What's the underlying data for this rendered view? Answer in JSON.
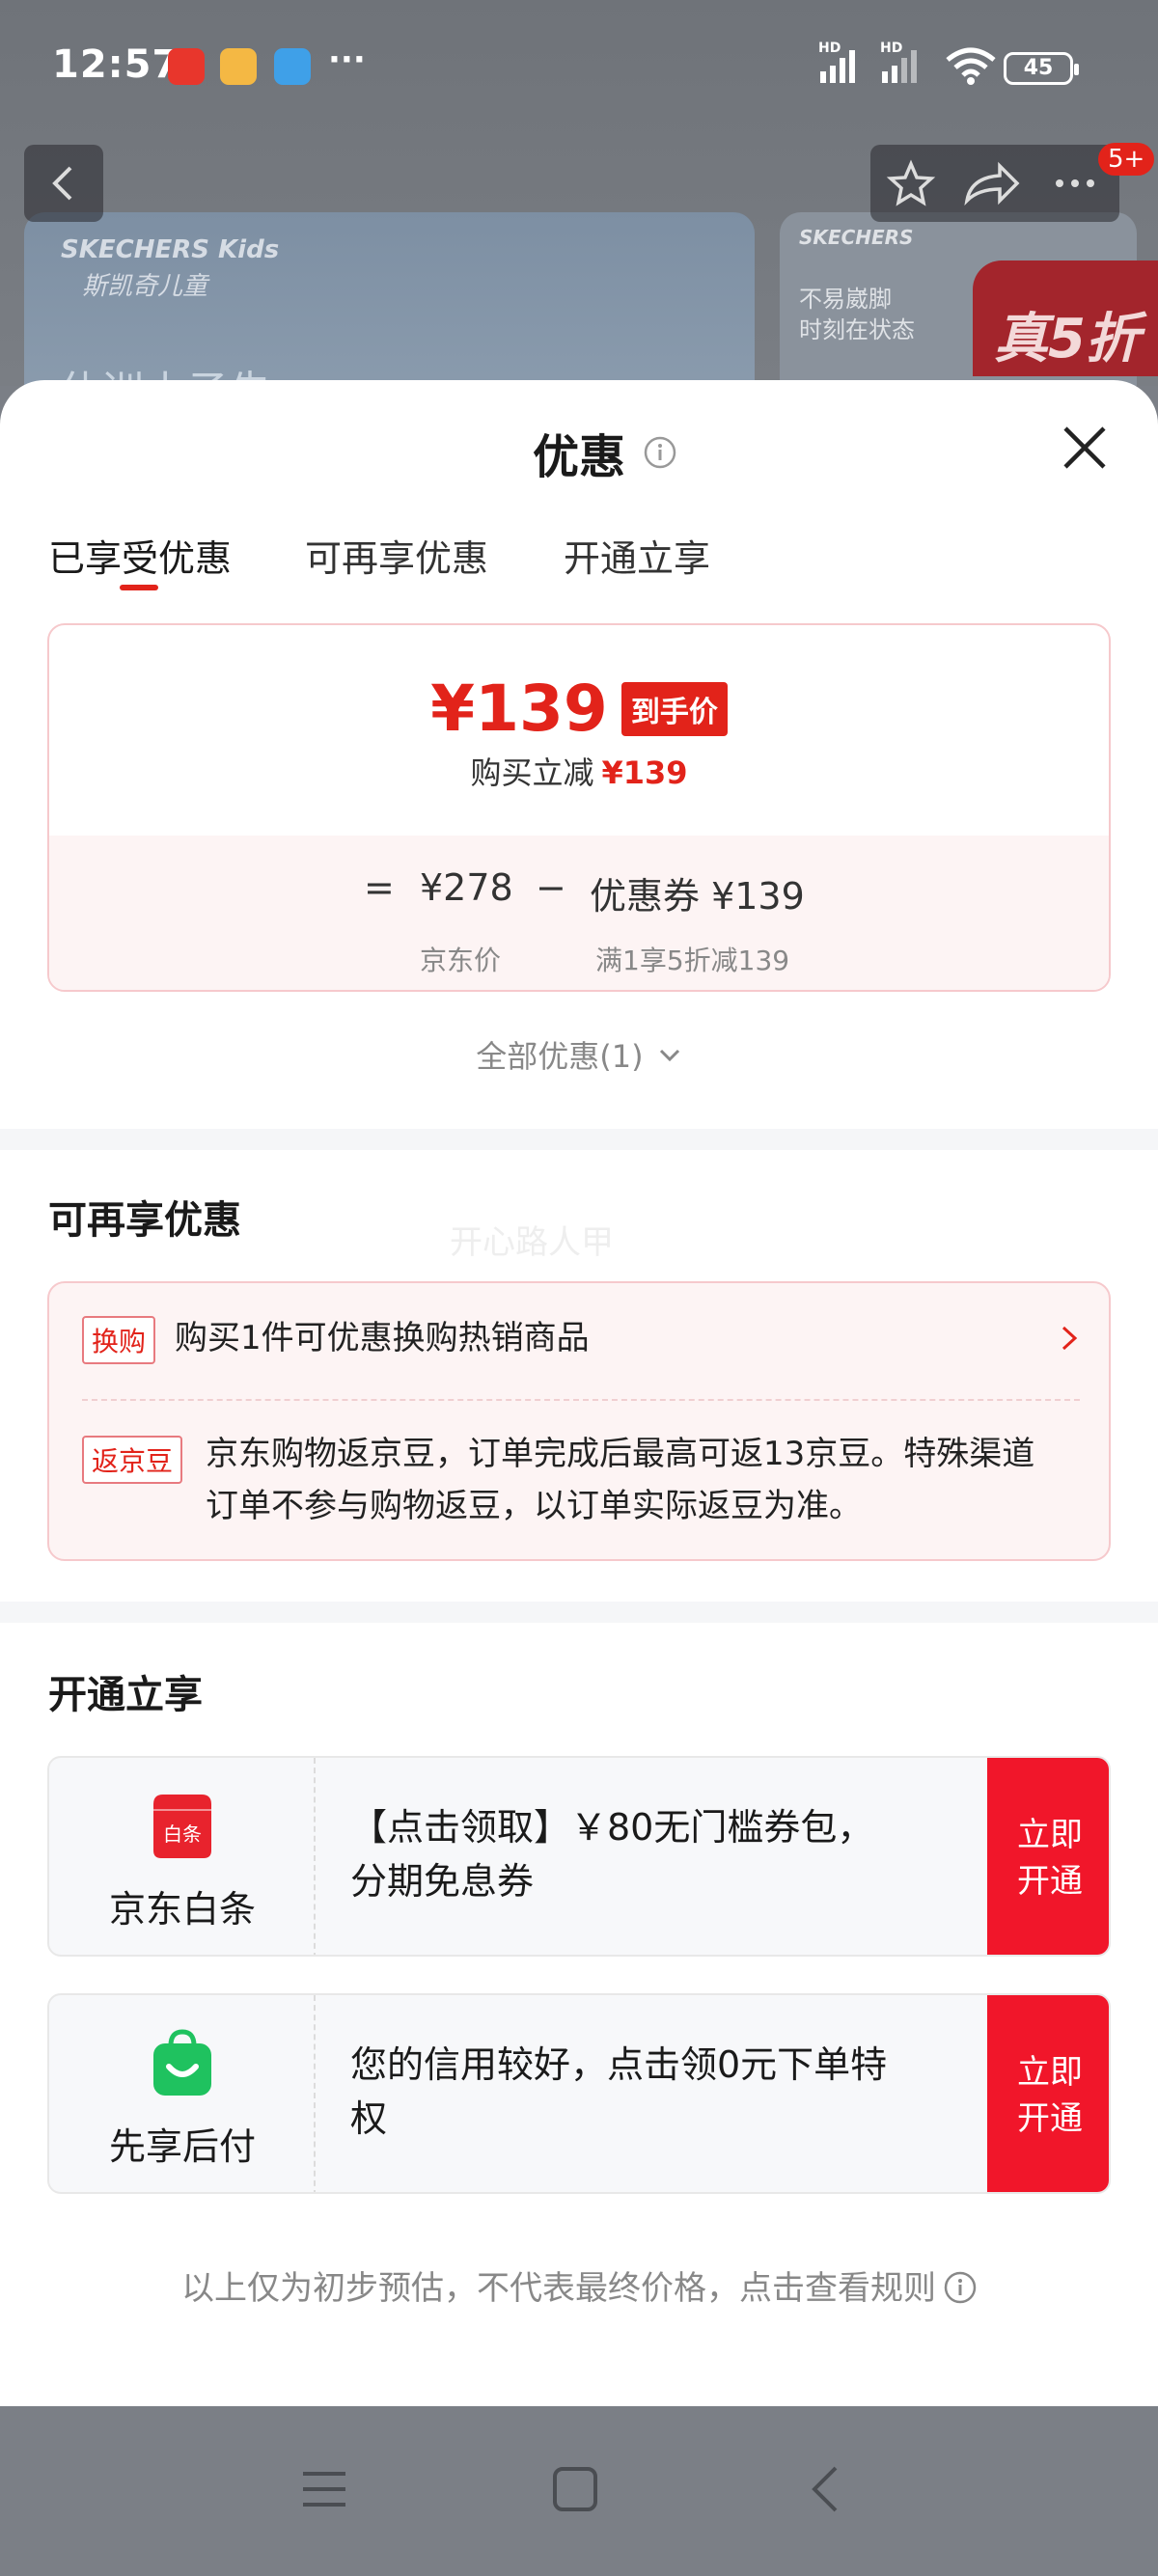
{
  "status_bar": {
    "time": "12:57",
    "battery": "45",
    "network1": "HD",
    "network2": "HD"
  },
  "background": {
    "badge": "5+",
    "banner1_logo": "SKECHERS Kids",
    "banner1_sub": "斯凯奇儿童",
    "banner1_big": "休训小子先",
    "banner2_logo": "SKECHERS",
    "banner2_line1": "不易崴脚",
    "banner2_line2": "时刻在状态",
    "banner2_promo": "真5折"
  },
  "sheet": {
    "title": "优惠",
    "tabs": [
      "已享受优惠",
      "可再享优惠",
      "开通立享"
    ],
    "price_card": {
      "price": "¥139",
      "price_tag": "到手价",
      "discount_label": "购买立减",
      "discount_value": "¥139",
      "eq": "=",
      "jd_price": "¥278",
      "minus": "−",
      "coupon": "优惠券 ¥139",
      "jd_price_label": "京东价",
      "coupon_label": "满1享5折减139"
    },
    "all_offers": "全部优惠(1)",
    "more_section": {
      "title": "可再享优惠",
      "watermark": "开心路人甲",
      "items": [
        {
          "tag": "换购",
          "text": "购买1件可优惠换购热销商品"
        },
        {
          "tag": "返京豆",
          "text1": "京东购物返京豆，订单完成后最高可返13京豆。特殊渠道",
          "text2": "订单不参与购物返豆，以订单实际返豆为准。"
        }
      ]
    },
    "open_section": {
      "title": "开通立享",
      "cards": [
        {
          "name": "京东白条",
          "icon_text": "白条",
          "desc1": "【点击领取】￥80无门槛券包，",
          "desc2": "分期免息券",
          "btn1": "立即",
          "btn2": "开通"
        },
        {
          "name": "先享后付",
          "desc1": "您的信用较好，点击领0元下单特",
          "desc2": "权",
          "btn1": "立即",
          "btn2": "开通"
        }
      ]
    },
    "disclaimer": "以上仅为初步预估，不代表最终价格，点击查看规则"
  },
  "colors": {
    "accent": "#e2231a",
    "button_red": "#f1162a",
    "card_border": "#f6c9cc",
    "card_bg": "#fdf4f4",
    "green_icon": "#1fc25f"
  }
}
